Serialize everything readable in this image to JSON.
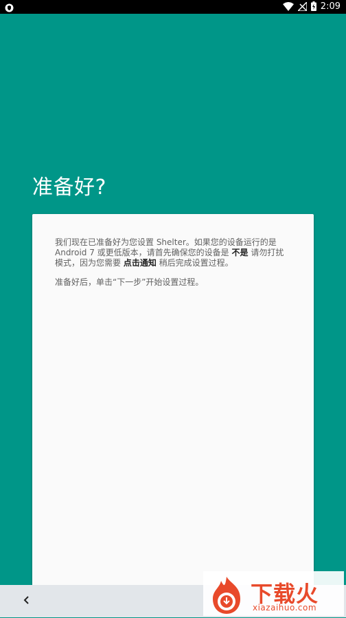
{
  "status_bar": {
    "time": "2:09",
    "icons": [
      "shield-icon",
      "wifi-icon",
      "no-signal-icon",
      "battery-charging-icon"
    ]
  },
  "page": {
    "title": "准备好?"
  },
  "card": {
    "para1_text1": "我们现在已准备好为您设置 Shelter。如果您的设备运行的是 Android 7 或更低版本，请首先确保您的设备是 ",
    "para1_bold1": "不是",
    "para1_text2": " 请勿打扰模式，因为您需要 ",
    "para1_bold2": "点击通知",
    "para1_text3": " 稍后完成设置过程。",
    "para2": "准备好后，单击“下一步”开始设置过程。"
  },
  "nav": {
    "back_icon": "chevron-left-icon"
  },
  "watermark": {
    "logo_text": "下载火",
    "url": "xiazaihuo.com"
  },
  "colors": {
    "background": "#009688",
    "card": "#fafafa",
    "nav_bar": "#e2e6ea",
    "watermark_accent": "#e84a2b"
  }
}
